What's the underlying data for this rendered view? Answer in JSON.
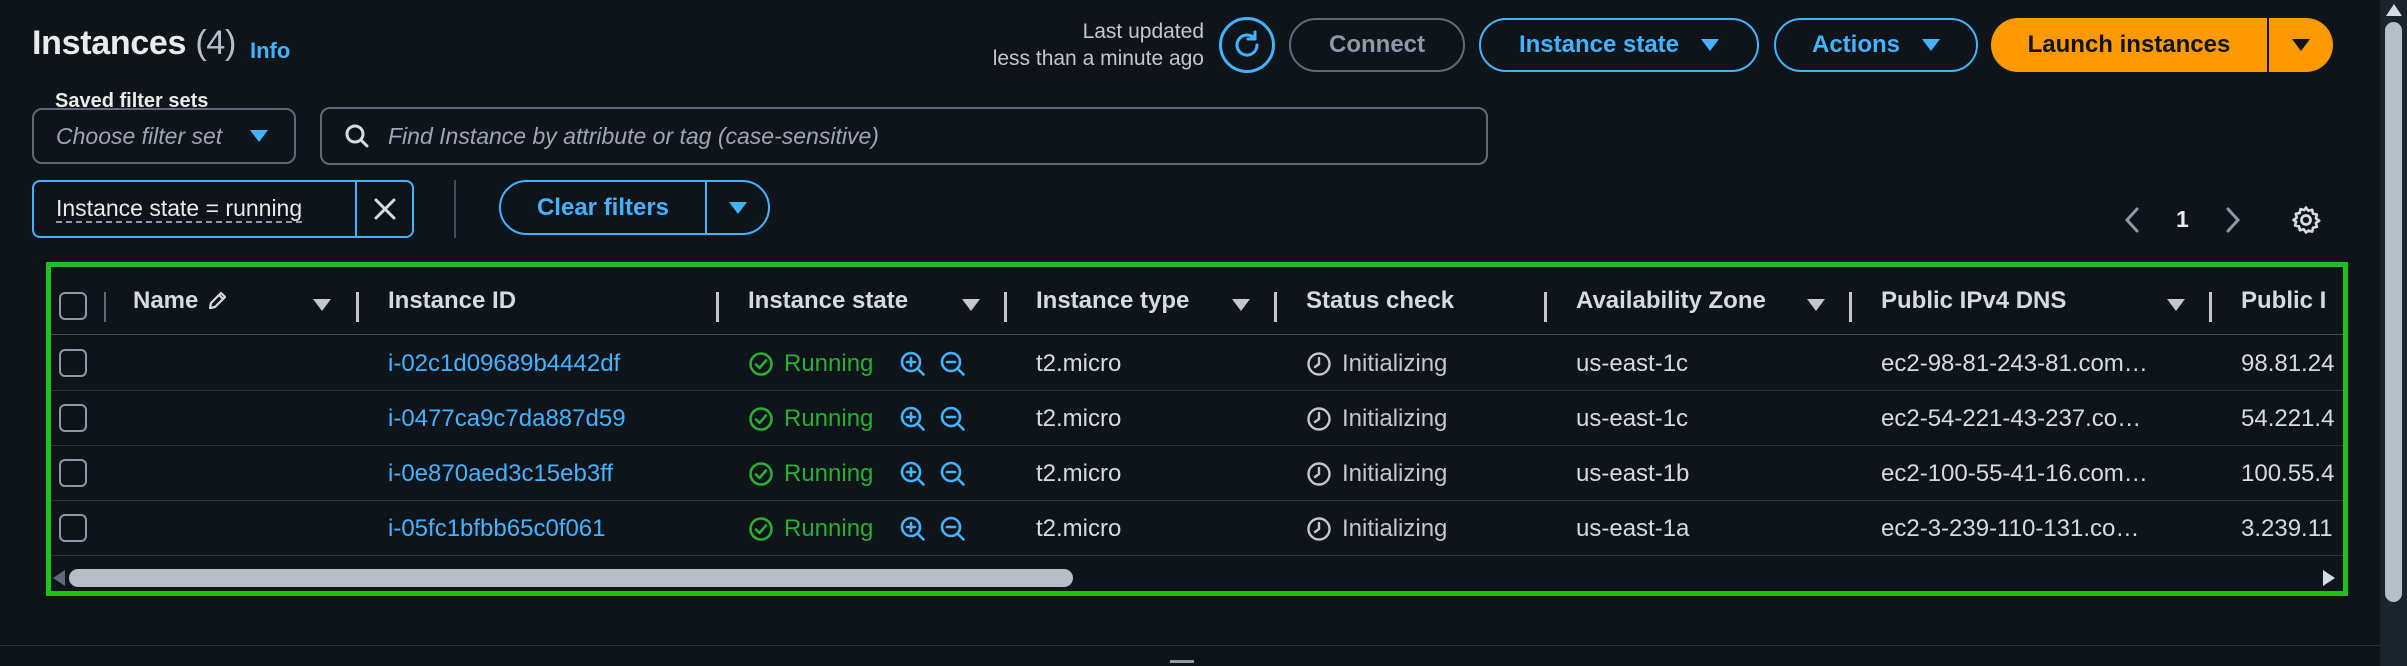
{
  "header": {
    "title": "Instances",
    "count": "(4)",
    "info_link": "Info",
    "last_updated_line1": "Last updated",
    "last_updated_line2": "less than a minute ago",
    "connect_label": "Connect",
    "instance_state_label": "Instance state",
    "actions_label": "Actions",
    "launch_label": "Launch instances"
  },
  "filters": {
    "saved_sets_label": "Saved filter sets",
    "saved_sets_placeholder": "Choose filter set",
    "search_placeholder": "Find Instance by attribute or tag (case-sensitive)",
    "active_token": "Instance state = running",
    "clear_label": "Clear filters"
  },
  "pagination": {
    "current_page": "1"
  },
  "table": {
    "columns": {
      "name": "Name",
      "instance_id": "Instance ID",
      "instance_state": "Instance state",
      "instance_type": "Instance type",
      "status_check": "Status check",
      "availability_zone": "Availability Zone",
      "public_dns": "Public IPv4 DNS",
      "public_ip": "Public I"
    },
    "rows": [
      {
        "name": "",
        "instance_id": "i-02c1d09689b4442df",
        "state": "Running",
        "type": "t2.micro",
        "status": "Initializing",
        "az": "us-east-1c",
        "dns": "ec2-98-81-243-81.com…",
        "ip": "98.81.24"
      },
      {
        "name": "",
        "instance_id": "i-0477ca9c7da887d59",
        "state": "Running",
        "type": "t2.micro",
        "status": "Initializing",
        "az": "us-east-1c",
        "dns": "ec2-54-221-43-237.co…",
        "ip": "54.221.4"
      },
      {
        "name": "",
        "instance_id": "i-0e870aed3c15eb3ff",
        "state": "Running",
        "type": "t2.micro",
        "status": "Initializing",
        "az": "us-east-1b",
        "dns": "ec2-100-55-41-16.com…",
        "ip": "100.55.4"
      },
      {
        "name": "",
        "instance_id": "i-05fc1bfbb65c0f061",
        "state": "Running",
        "type": "t2.micro",
        "status": "Initializing",
        "az": "us-east-1a",
        "dns": "ec2-3-239-110-131.co…",
        "ip": "3.239.11"
      }
    ]
  },
  "colors": {
    "accent": "#42b4ff",
    "launch": "#ff9900",
    "running": "#29ad32",
    "highlight": "#1ec21e",
    "background": "#0f141a"
  }
}
